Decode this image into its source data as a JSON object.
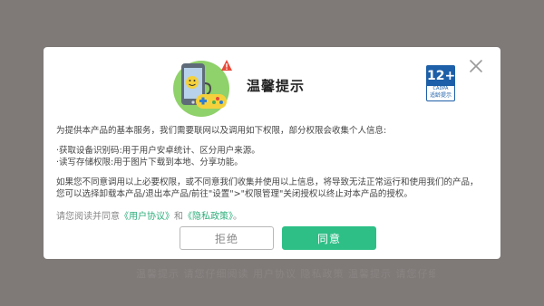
{
  "dialog": {
    "title": "温馨提示",
    "age_badge": {
      "num": "12+",
      "code": "CADPA",
      "caption": "适龄提示"
    },
    "intro": "为提供本产品的基本服务，我们需要联网以及调用如下权限，部分权限会收集个人信息:",
    "permissions": [
      "·获取设备识别码:用于用户安卓统计、区分用户来源。",
      "·读写存储权限:用于图片下载到本地、分享功能。"
    ],
    "refusal_note": "如果您不同意调用以上必要权限，或不同意我们收集并使用以上信息，将导致无法正常运行和使用我们的产品，您可以选择卸载本产品/退出本产品/前往\"设置\">\"权限管理\"关闭授权以终止对本产品的授权。",
    "agree_prefix": "请您阅读并同意",
    "user_agreement_link": "《用户协议》",
    "agree_and": "和",
    "privacy_link": "《隐私政策》",
    "agree_suffix": "。",
    "decline_label": "拒绝",
    "accept_label": "同意"
  },
  "background": {
    "ghost_text": "温馨提示 请您仔细阅读 用户协议 隐私政策 温馨提示 请您仔细"
  },
  "icons": {
    "close": "close-icon",
    "illustration": "phone-gamepad-icon",
    "warning": "warning-icon"
  },
  "colors": {
    "accent": "#2dbf86",
    "link": "#2fae7c",
    "badge_blue": "#1d5fa8",
    "overlay": "#7f7a78"
  }
}
